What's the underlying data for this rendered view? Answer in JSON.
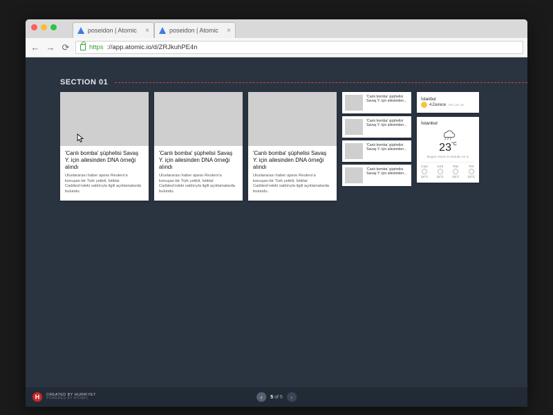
{
  "browser": {
    "tabs": [
      {
        "title": "poseidon | Atomic"
      },
      {
        "title": "poseidon | Atomic"
      }
    ],
    "url_secure": "https",
    "url_rest": "://app.atomic.io/d/ZRJkuhPE4n"
  },
  "section": {
    "title": "SECTION 01"
  },
  "cards": [
    {
      "title": "'Canlı bomba' şüphelisi Savaş Y. için ailesinden DNA örneği alındı",
      "desc": "Uluslararası haber ajansı Reuters'a konuşan bir Türk yetkili, İstiklal Caddesi'ndeki saldırıyla ilgili açıklamalarda bulundu."
    },
    {
      "title": "'Canlı bomba' şüphelisi Savaş Y. için ailesinden DNA örneği alındı",
      "desc": "Uluslararası haber ajansı Reuters'a konuşan bir Türk yetkili, İstiklal Caddesi'ndeki saldırıyla ilgili açıklamalarda bulundu."
    },
    {
      "title": "'Canlı bomba' şüphelisi Savaş Y. için ailesinden DNA örneği alındı",
      "desc": "Uluslararası haber ajansı Reuters'a konuşan bir Türk yetkili, İstiklal Caddesi'ndeki saldırıyla ilgili açıklamalarda bulundu."
    }
  ],
  "small_items": [
    {
      "text": "'Canlı bomba' şüphelisi Savaş Y. için ailesinden..."
    },
    {
      "text": "'Canlı bomba' şüphelisi Savaş Y. için ailesinden..."
    },
    {
      "text": "'Canlı bomba' şüphelisi Savaş Y. için ailesinden..."
    },
    {
      "text": "'Canlı bomba' şüphelisi Savaş Y. için ailesinden..."
    }
  ],
  "weather": {
    "small": {
      "city": "İstanbul",
      "degree": "4.Derece",
      "sub": "Akıcı yer yer"
    },
    "big": {
      "city": "İstanbul",
      "temp": "23",
      "unit": "°C",
      "status": "Bugün Hava Az Bulutlu ve G",
      "forecast": [
        {
          "day": "Cum",
          "t": "23°C"
        },
        {
          "day": "Cmt",
          "t": "23°C"
        },
        {
          "day": "Paz",
          "t": "23°C"
        },
        {
          "day": "Pzt",
          "t": "23°C"
        }
      ]
    }
  },
  "footer": {
    "badge": "H",
    "line1": "CREATED BY HURRIYET",
    "line2": "POWERED BY ATOMIC",
    "pager_current": "5",
    "pager_of": "of",
    "pager_total": "5"
  }
}
